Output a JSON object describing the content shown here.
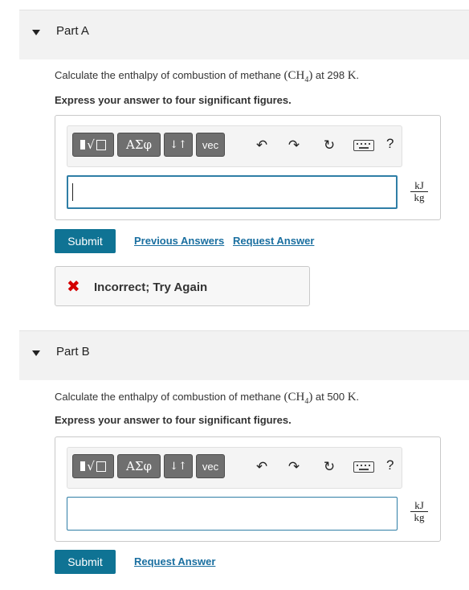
{
  "part_a": {
    "title": "Part A",
    "question_prefix": "Calculate the enthalpy of combustion of methane ",
    "formula_base": "(CH",
    "formula_sub": "4",
    "formula_close": ")",
    "question_mid": " at 298 ",
    "temp_unit": "K",
    "question_end": ".",
    "instruction": "Express your answer to four significant figures.",
    "input_value": "",
    "unit_numerator": "kJ",
    "unit_denominator": "kg",
    "submit_label": "Submit",
    "previous_answers_label": "Previous Answers",
    "request_answer_label": "Request Answer",
    "feedback_text": "Incorrect; Try Again"
  },
  "part_b": {
    "title": "Part B",
    "question_prefix": "Calculate the enthalpy of combustion of methane ",
    "formula_base": "(CH",
    "formula_sub": "4",
    "formula_close": ")",
    "question_mid": " at 500 ",
    "temp_unit": "K",
    "question_end": ".",
    "instruction": "Express your answer to four significant figures.",
    "input_value": "",
    "unit_numerator": "kJ",
    "unit_denominator": "kg",
    "submit_label": "Submit",
    "request_answer_label": "Request Answer"
  },
  "toolbar": {
    "greek_label": "ΑΣφ",
    "arrows_label": "↓↑",
    "vec_label": "vec",
    "help_label": "?"
  },
  "icons": {
    "templates": "square-root-template-icon",
    "undo": "undo-icon",
    "redo": "redo-icon",
    "reset": "reset-icon",
    "keyboard": "keyboard-icon",
    "collapse": "collapse-triangle-icon",
    "incorrect": "x-mark-icon"
  },
  "colors": {
    "submit_bg": "#0f7394",
    "link": "#1a6fa0",
    "incorrect": "#d40000",
    "header_bg": "#f2f2f2"
  }
}
